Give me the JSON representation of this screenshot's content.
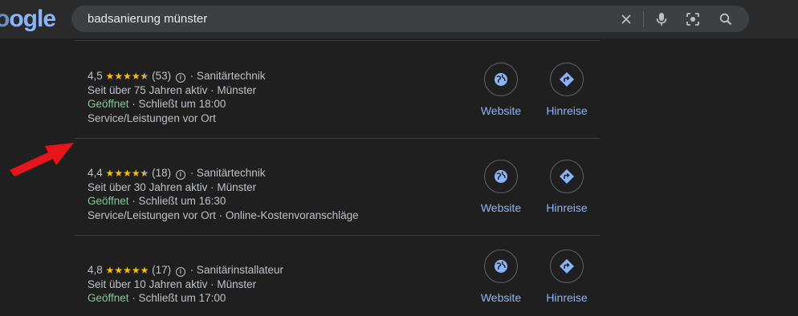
{
  "header": {
    "logo_text": "ogle",
    "search_value": "badsanierung münster"
  },
  "icons": {
    "clear": "close-icon",
    "voice": "microphone-icon",
    "lens": "lens-icon",
    "search": "search-icon"
  },
  "results": [
    {
      "rating": "4,5",
      "stars": 4.5,
      "reviews": "(53)",
      "info_glyph": "i",
      "category": "· Sanitärtechnik",
      "years": "Seit über 75 Jahren aktiv · Münster",
      "open": "Geöffnet",
      "closes": "· Schließt um 18:00",
      "service": "Service/Leistungen vor Ort",
      "website_label": "Website",
      "directions_label": "Hinreise"
    },
    {
      "rating": "4,4",
      "stars": 4.5,
      "reviews": "(18)",
      "info_glyph": "i",
      "category": "· Sanitärtechnik",
      "years": "Seit über 30 Jahren aktiv · Münster",
      "open": "Geöffnet",
      "closes": "· Schließt um 16:30",
      "service": "Service/Leistungen vor Ort · Online-Kostenvoranschläge",
      "website_label": "Website",
      "directions_label": "Hinreise"
    },
    {
      "rating": "4,8",
      "stars": 5,
      "reviews": "(17)",
      "info_glyph": "i",
      "category": "· Sanitärinstallateur",
      "years": "Seit über 10 Jahren aktiv · Münster",
      "open": "Geöffnet",
      "closes": "· Schließt um 17:00",
      "website_label": "Website",
      "directions_label": "Hinreise"
    }
  ],
  "colors": {
    "background": "#1f1f1f",
    "link": "#8ab4f8",
    "open": "#81c995",
    "star": "#fbbc04",
    "annotation_arrow": "#e8141b"
  }
}
